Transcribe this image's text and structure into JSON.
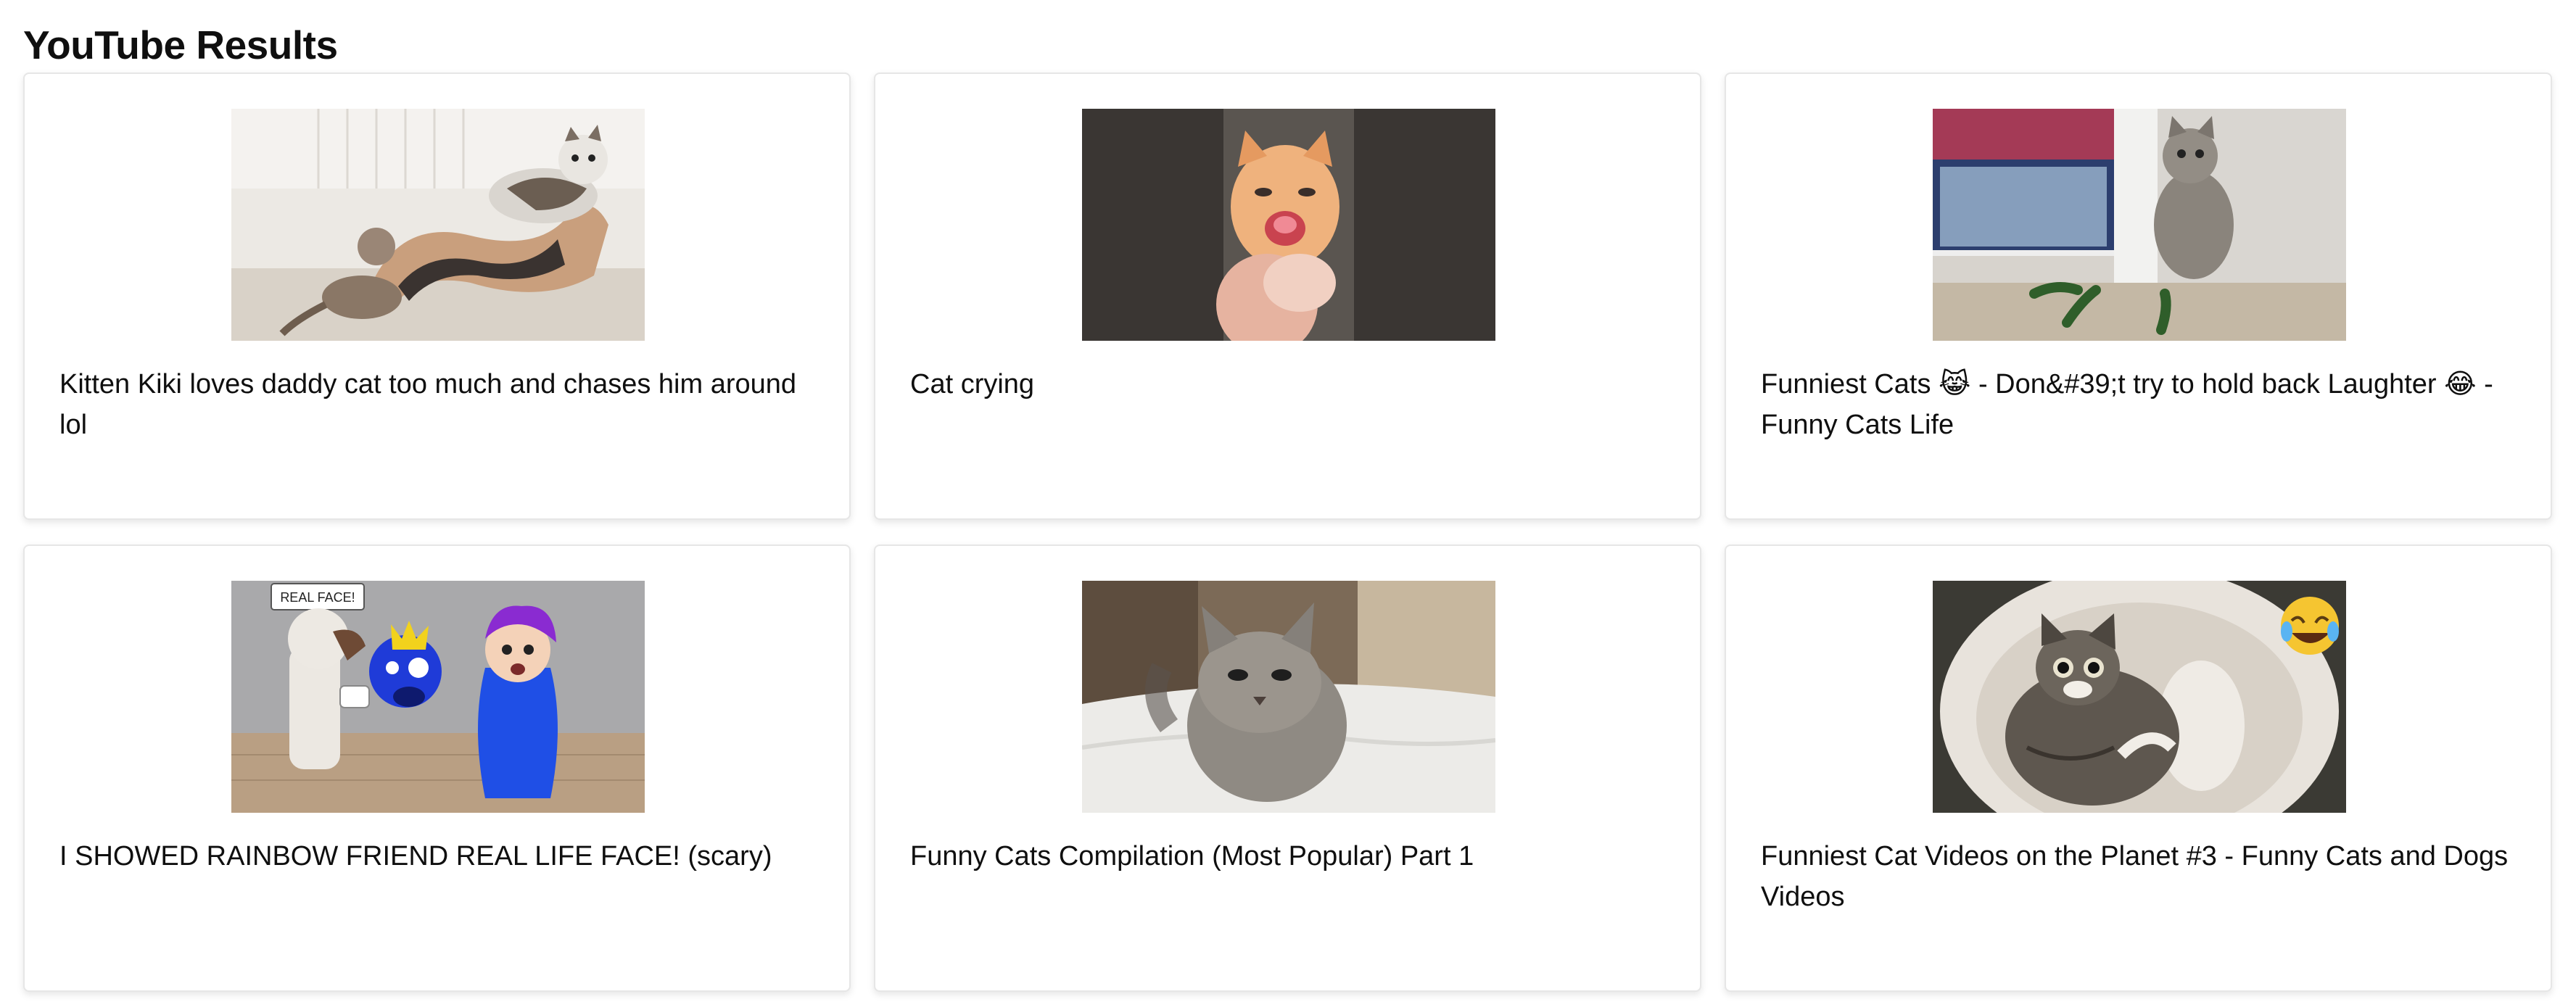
{
  "page": {
    "title": "YouTube Results"
  },
  "videos": [
    {
      "title": "Kitten Kiki loves daddy cat too much and chases him around lol",
      "thumbnail": "cats-on-cat-scratcher"
    },
    {
      "title": "Cat crying",
      "thumbnail": "orange-kitten-crying"
    },
    {
      "title": "Funniest Cats 😹 - Don&#39;t try to hold back Laughter 😂 - Funny Cats Life",
      "thumbnail": "cat-standing-by-fridge-cucumbers"
    },
    {
      "title": "I SHOWED RAINBOW FRIEND REAL LIFE FACE! (scary)",
      "thumbnail": "roblox-rainbow-friends",
      "thumbnail_caption": "REAL FACE!"
    },
    {
      "title": "Funny Cats Compilation (Most Popular) Part 1",
      "thumbnail": "grey-cat-on-bed"
    },
    {
      "title": "Funniest Cat Videos on the Planet #3 - Funny Cats and Dogs Videos",
      "thumbnail": "cat-in-sink-laughing-emoji"
    }
  ],
  "colors": {
    "text": "#0f0f0f",
    "card_border": "#e6e6e6",
    "background": "#ffffff"
  }
}
